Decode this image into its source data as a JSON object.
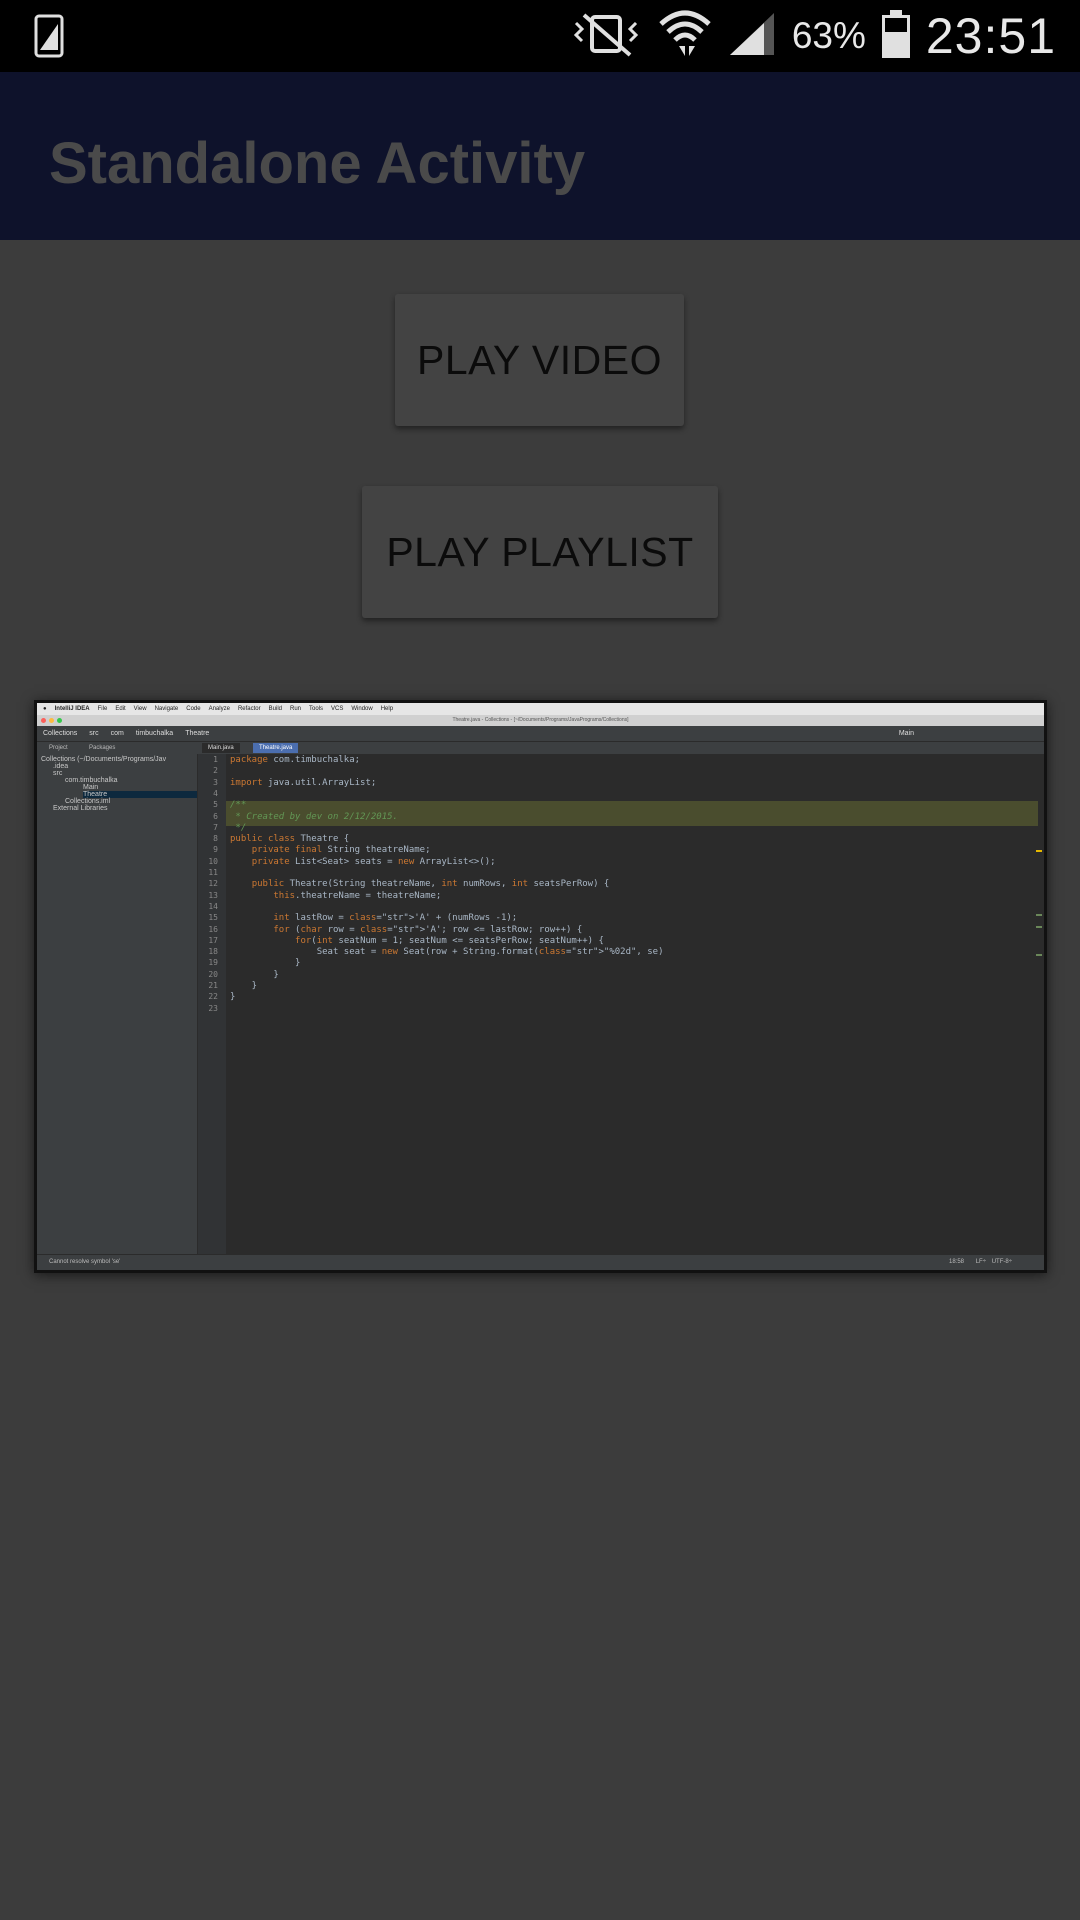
{
  "status_bar": {
    "battery_percent": "63%",
    "time": "23:51"
  },
  "action_bar": {
    "title": "Standalone Activity"
  },
  "buttons": {
    "play_video": "PLAY VIDEO",
    "play_playlist": "PLAY PLAYLIST"
  },
  "thumbnail": {
    "menu_items": [
      "IntelliJ IDEA",
      "File",
      "Edit",
      "View",
      "Navigate",
      "Code",
      "Analyze",
      "Refactor",
      "Build",
      "Run",
      "Tools",
      "VCS",
      "Window",
      "Help"
    ],
    "window_title": "Theatre.java - Collections - [~/Documents/Programs/JavaPrograms/Collections]",
    "breadcrumbs": [
      "Collections",
      "src",
      "com",
      "timbuchalka",
      "Theatre"
    ],
    "run_config": "Main",
    "pane_tabs": [
      "Project",
      "Packages"
    ],
    "editor_tabs": [
      "Main.java",
      "Theatre.java"
    ],
    "tree": [
      "Collections  (~/Documents/Programs/Jav",
      ".idea",
      "src",
      "com.timbuchalka",
      "Main",
      "Theatre",
      "Collections.iml",
      "External Libraries"
    ],
    "code_lines": [
      "package com.timbuchalka;",
      "",
      "import java.util.ArrayList;",
      "",
      "/**",
      " * Created by dev on 2/12/2015.",
      " */",
      "public class Theatre {",
      "    private final String theatreName;",
      "    private List<Seat> seats = new ArrayList<>();",
      "",
      "    public Theatre(String theatreName, int numRows, int seatsPerRow) {",
      "        this.theatreName = theatreName;",
      "",
      "        int lastRow = 'A' + (numRows -1);",
      "        for (char row = 'A'; row <= lastRow; row++) {",
      "            for(int seatNum = 1; seatNum <= seatsPerRow; seatNum++) {",
      "                Seat seat = new Seat(row + String.format(\"%02d\", se)",
      "            }",
      "        }",
      "    }",
      "}",
      ""
    ],
    "status_message": "Cannot resolve symbol 'se'",
    "status_right": [
      "18:58",
      "LF÷",
      "UTF-8÷"
    ]
  }
}
